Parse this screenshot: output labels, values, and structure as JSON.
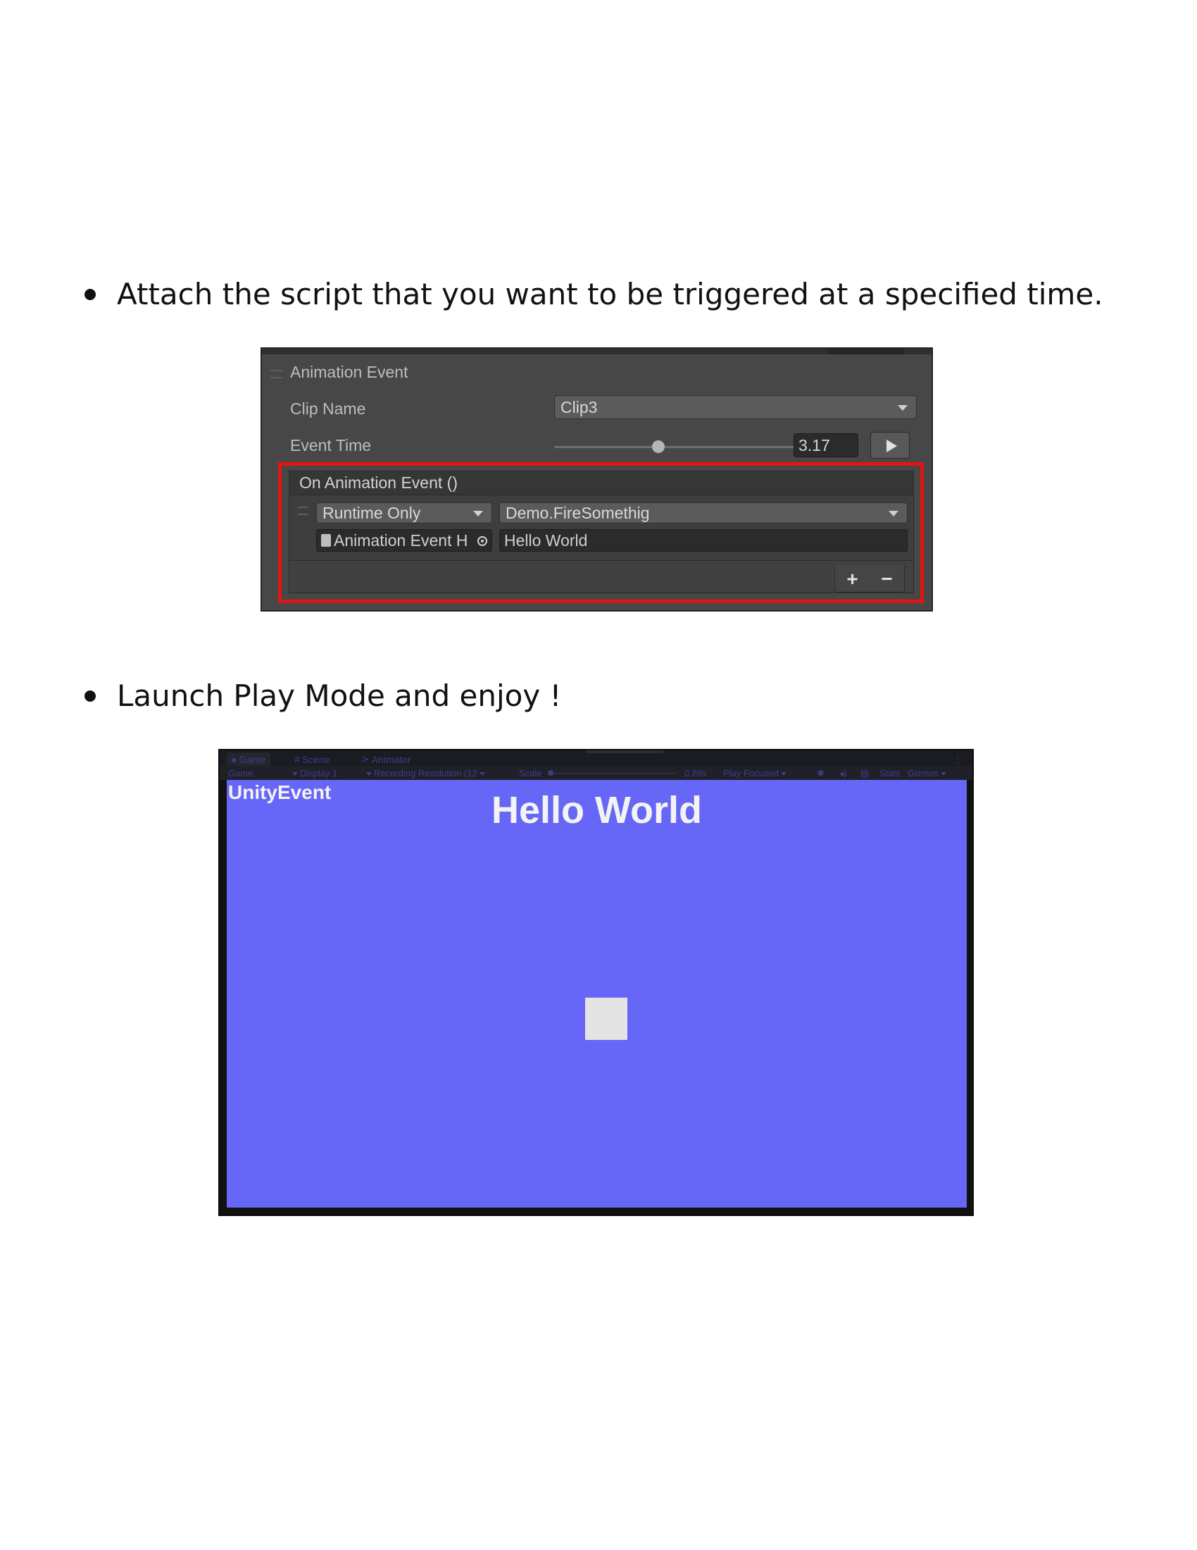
{
  "bullets": [
    "Attach the script that you want to be triggered at a specified time.",
    "Launch Play Mode and enjoy !"
  ],
  "inspector": {
    "title": "Animation Event",
    "clip_name_label": "Clip Name",
    "clip_name_value": "Clip3",
    "event_time_label": "Event Time",
    "event_time_value": "3.17",
    "event_header": "On Animation Event ()",
    "runtime_option": "Runtime Only",
    "function_value": "Demo.FireSomethig",
    "object_value": "Animation Event H",
    "argument_value": "Hello World",
    "plus_label": "+",
    "minus_label": "−",
    "highlight_color": "#e21414"
  },
  "game_window": {
    "tabs": [
      "Game",
      "Scene",
      "Animator"
    ],
    "tab_icons": [
      "gamepad-icon",
      "grid-icon",
      "animator-icon"
    ],
    "toolbar": {
      "mode": "Game",
      "display": "Display 1",
      "resolution": "Recording Resolution (12",
      "scale_label": "Scale",
      "scale_value": "0.89x",
      "play_focused": "Play Focused",
      "stats": "Stats",
      "gizmos": "Gizmos"
    },
    "unity_label": "UnityEvent",
    "hello_text": "Hello World",
    "background_color": "#6767f7"
  }
}
